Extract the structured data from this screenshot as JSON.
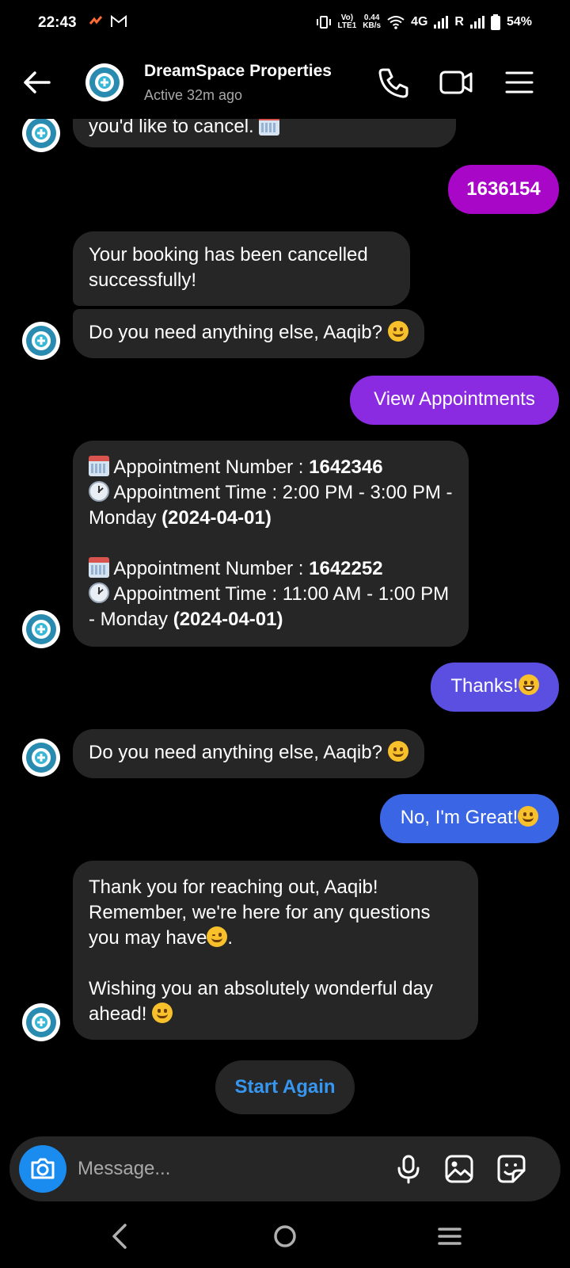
{
  "status_bar": {
    "time": "22:43",
    "speed_value": "0.44",
    "speed_unit": "KB/s",
    "volte_top": "Vo)",
    "volte_bottom": "LTE1",
    "network": "4G",
    "roaming": "R",
    "battery": "54%"
  },
  "header": {
    "title": "DreamSpace Properties",
    "status": "Active 32m ago"
  },
  "messages": {
    "m0": {
      "text": "you'd like to cancel. "
    },
    "m1": {
      "text": "1636154"
    },
    "m2": {
      "text": "Your booking has been cancelled successfully!"
    },
    "m3": {
      "text": "Do you need anything else, Aaqib? "
    },
    "m4": {
      "text": "View Appointments"
    },
    "m5": {
      "a1_label": "Appointment Number : ",
      "a1_number": "1642346",
      "a1_time_label": "Appointment Time : 2:00 PM - 3:00 PM - Monday ",
      "a1_date": "(2024-04-01)",
      "a2_label": "Appointment Number : ",
      "a2_number": "1642252",
      "a2_time_label": "Appointment Time : 11:00 AM - 1:00 PM - Monday ",
      "a2_date": "(2024-04-01)"
    },
    "m6": {
      "text": "Thanks!"
    },
    "m7": {
      "text": "Do you need anything else, Aaqib? "
    },
    "m8": {
      "text": "No, I'm Great!"
    },
    "m9": {
      "line1": "Thank you for reaching out, Aaqib! Remember, we're here for any questions you may have",
      "line2": "Wishing you an absolutely wonderful day ahead! "
    }
  },
  "start_again_label": "Start Again",
  "composer": {
    "placeholder": "Message..."
  },
  "colors": {
    "bubble_incoming": "#262626",
    "bubble_out_1": "#a807c8",
    "bubble_out_2": "#8a2be2",
    "bubble_out_3": "#5a4fe0",
    "bubble_out_4": "#3a66e6",
    "accent_blue": "#3797f0"
  }
}
